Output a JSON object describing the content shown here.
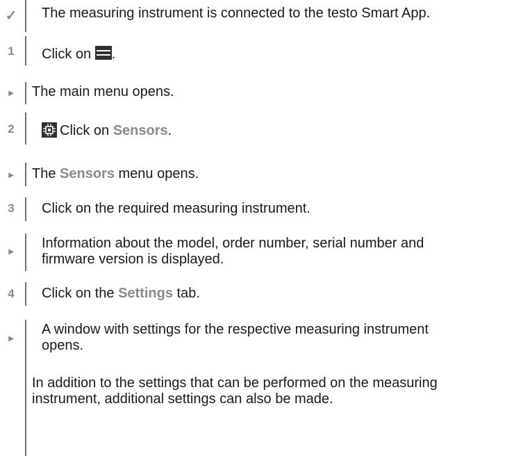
{
  "steps": [
    {
      "marker": "✓",
      "text": "The measuring instrument is connected to the testo Smart App."
    },
    {
      "marker": "1",
      "before": "Click on ",
      "after": "."
    },
    {
      "marker": "▸",
      "text": "The main menu opens."
    },
    {
      "marker": "2",
      "before": "Click on ",
      "hl": "Sensors",
      "after": "."
    },
    {
      "marker": "▸",
      "before": "The ",
      "hl": "Sensors",
      "after": " menu opens."
    },
    {
      "marker": "3",
      "text": "Click on the required measuring instrument."
    },
    {
      "marker": "▸",
      "line1": "Information about the model, order number, serial number and",
      "line2": "firmware version is displayed."
    },
    {
      "marker": "4",
      "before": "Click on the ",
      "hl": "Settings",
      "after": " tab."
    },
    {
      "marker": "▸",
      "line1": "A window with settings for the respective measuring instrument",
      "line2": "opens."
    }
  ],
  "note": {
    "line1": "In addition to the settings that can be performed on the measuring",
    "line2": "instrument, additional settings can also be made."
  },
  "icons": {
    "menu": "hamburger-menu-icon",
    "sensors": "sensor-chip-icon"
  },
  "colors": {
    "highlight": "#8a8a8a",
    "text": "#1a1a1a",
    "rule": "#6f6f6f"
  }
}
